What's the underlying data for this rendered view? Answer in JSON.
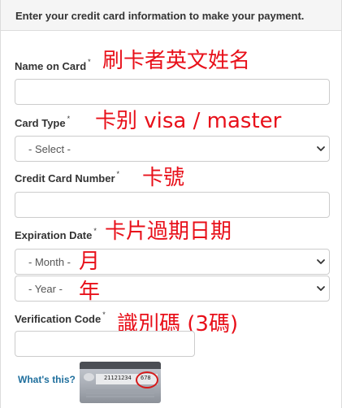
{
  "header": {
    "title": "Enter your credit card information to make your payment."
  },
  "form": {
    "required_mark": "*",
    "name_on_card": {
      "label": "Name on Card",
      "value": "",
      "note": "刷卡者英文姓名"
    },
    "card_type": {
      "label": "Card Type",
      "selected": "- Select -",
      "note": "卡别 visa / master"
    },
    "card_number": {
      "label": "Credit Card Number",
      "value": "",
      "note": "卡號"
    },
    "expiration": {
      "label": "Expiration Date",
      "note": "卡片過期日期",
      "month_selected": "- Month -",
      "month_note": "月",
      "year_selected": "- Year -",
      "year_note": "年"
    },
    "verification": {
      "label": "Verification Code",
      "value": "",
      "note": "識別碼 (3碼)"
    }
  },
  "help": {
    "whats_this": "What's this?",
    "card_number_sample": "21121234",
    "cvv_sample": "678"
  },
  "colors": {
    "note_red": "#e8101a",
    "link_blue": "#1f6f9d",
    "border": "#cccccc"
  },
  "icons": {
    "select_arrow": "chevron-down-icon",
    "card_image": "credit-card-back-icon"
  }
}
